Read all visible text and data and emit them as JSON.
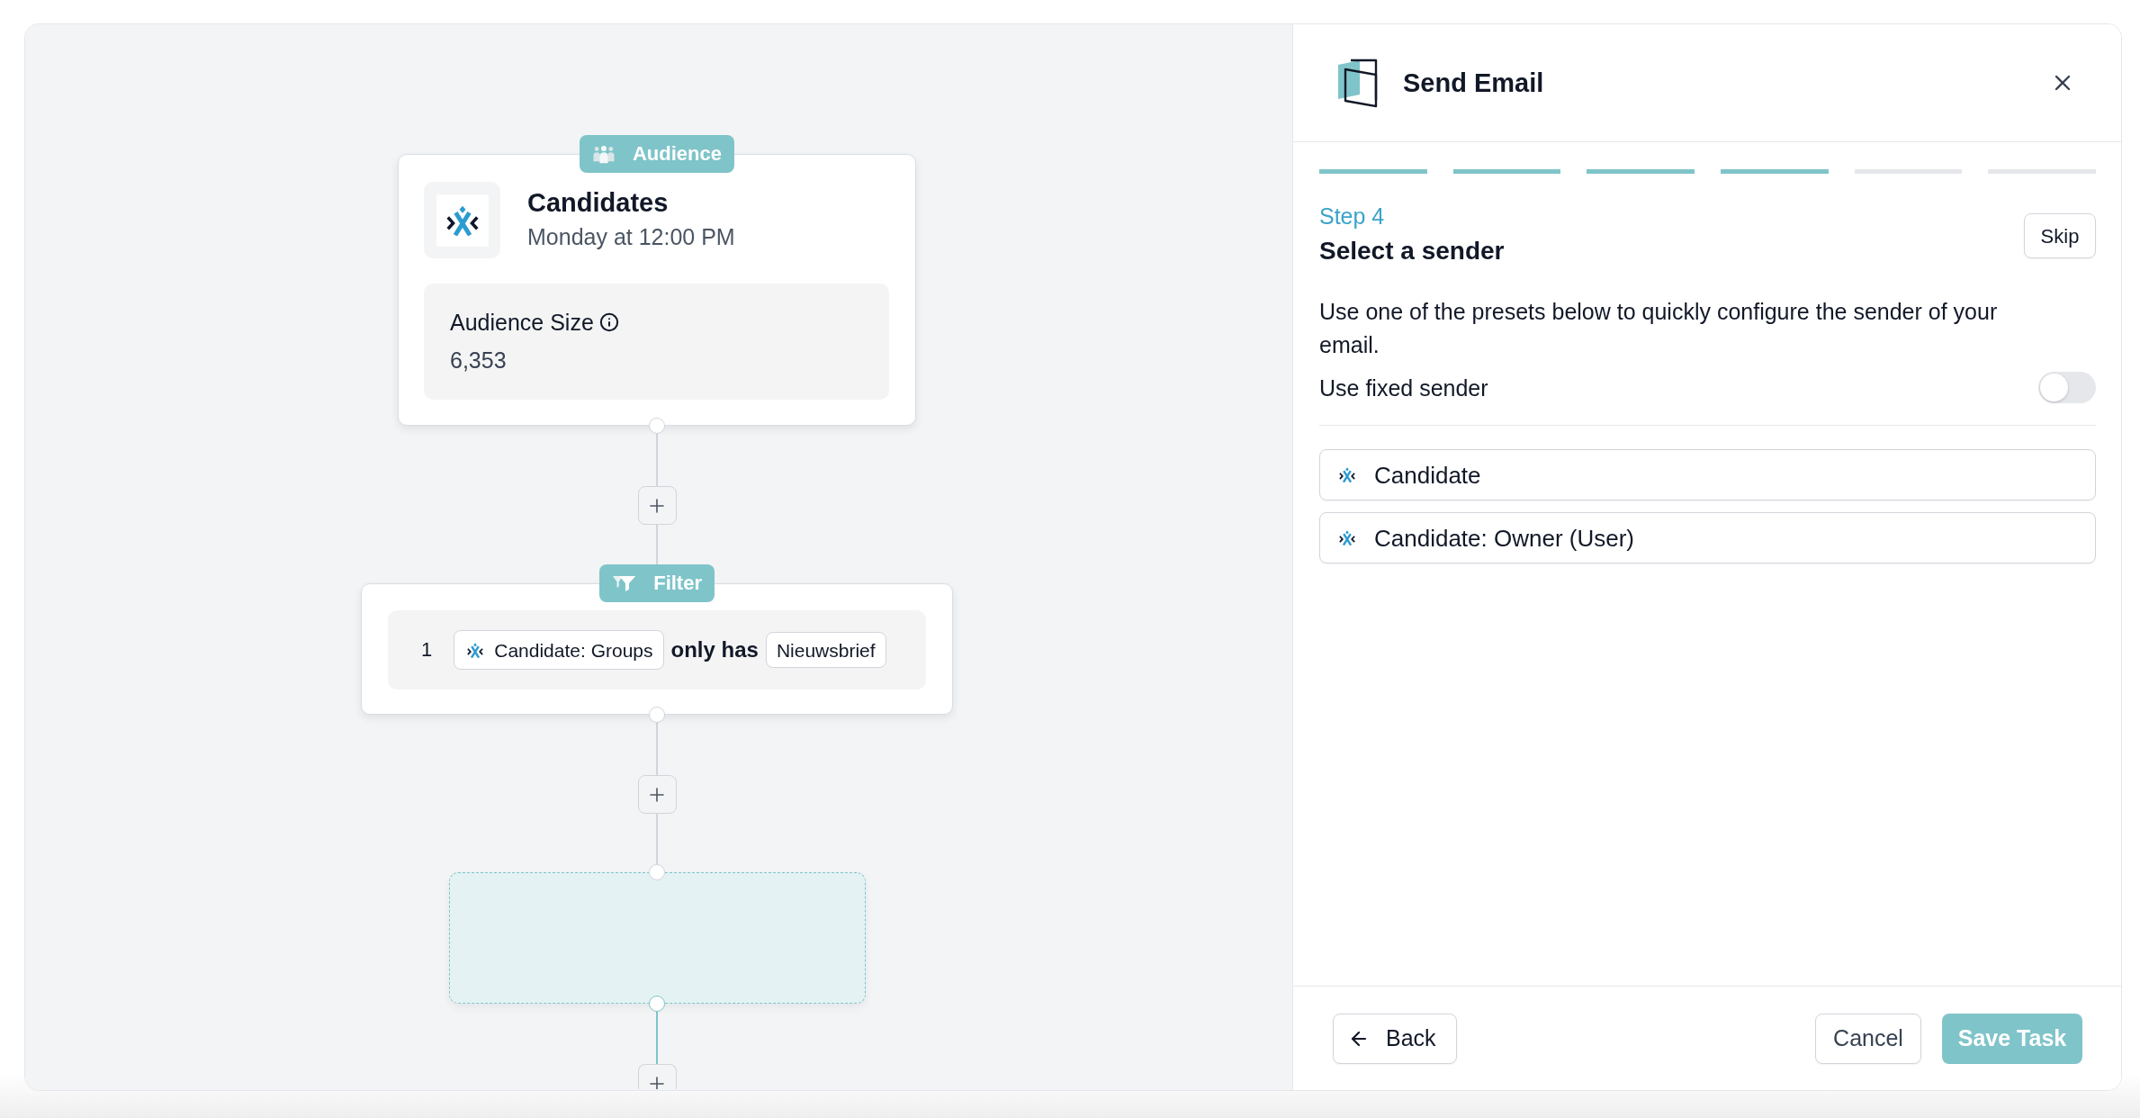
{
  "canvas": {
    "nodes": [
      {
        "kind": "audience",
        "tag": "Audience",
        "title": "Candidates",
        "schedule": "Monday at 12:00 PM",
        "stat_label": "Audience Size",
        "stat_value": "6,353"
      },
      {
        "kind": "filter",
        "tag": "Filter",
        "conditions": [
          {
            "index": "1",
            "field": "Candidate: Groups",
            "operator": "only has",
            "value": "Nieuwsbrief"
          }
        ]
      },
      {
        "kind": "placeholder"
      }
    ]
  },
  "panel": {
    "title": "Send Email",
    "steps": [
      {
        "completed": true
      },
      {
        "completed": true
      },
      {
        "completed": true
      },
      {
        "completed": true
      },
      {
        "completed": false
      },
      {
        "completed": false
      }
    ],
    "step_label": "Step 4",
    "heading": "Select a sender",
    "skip_button": "Skip",
    "description": "Use one of the presets below to quickly configure the sender of your email.",
    "fixed_sender": {
      "label": "Use fixed sender",
      "on": false
    },
    "presets": [
      {
        "label": "Candidate"
      },
      {
        "label": "Candidate: Owner (User)"
      }
    ],
    "footer": {
      "back_button": "Back",
      "cancel_button": "Cancel",
      "save_button": "Save Task"
    }
  }
}
